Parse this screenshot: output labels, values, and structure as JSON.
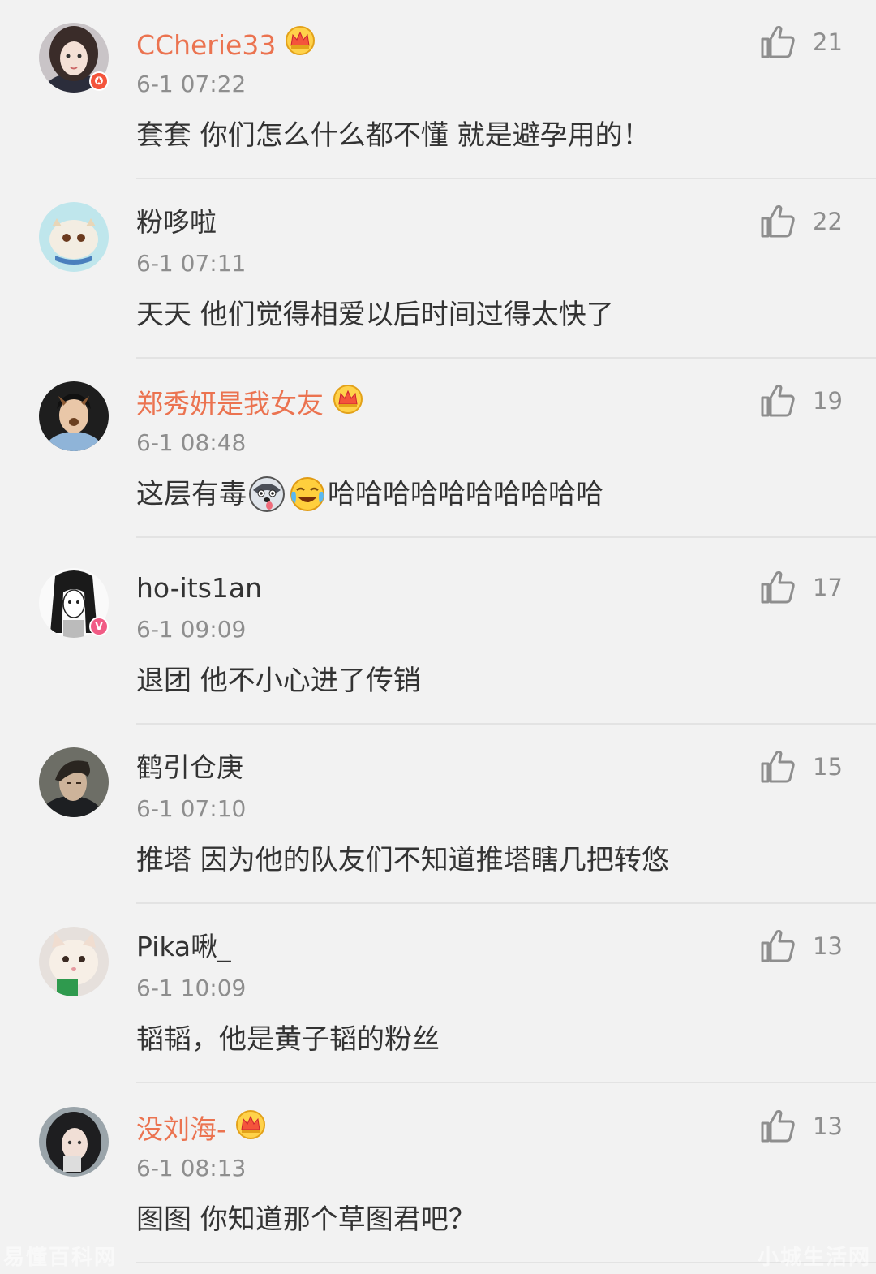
{
  "comments": [
    {
      "name": "CCherie33",
      "vip": true,
      "time": "6-1 07:22",
      "text_a": "套套 你们怎么什么都不懂 就是避孕用的！",
      "text_b": "",
      "likes": "21",
      "badge": "star"
    },
    {
      "name": "粉哆啦",
      "vip": false,
      "time": "6-1 07:11",
      "text_a": "天天  他们觉得相爱以后时间过得太快了",
      "text_b": "",
      "likes": "22",
      "badge": ""
    },
    {
      "name": "郑秀妍是我女友",
      "vip": true,
      "time": "6-1 08:48",
      "text_a": "这层有毒",
      "text_b": "哈哈哈哈哈哈哈哈哈哈",
      "likes": "19",
      "badge": ""
    },
    {
      "name": "ho-its1an",
      "vip": false,
      "time": "6-1 09:09",
      "text_a": "退团 他不小心进了传销",
      "text_b": "",
      "likes": "17",
      "badge": "v"
    },
    {
      "name": "鹤引仓庚",
      "vip": false,
      "time": "6-1 07:10",
      "text_a": "推塔  因为他的队友们不知道推塔瞎几把转悠",
      "text_b": "",
      "likes": "15",
      "badge": ""
    },
    {
      "name": "Pika啾_",
      "vip": false,
      "time": "6-1 10:09",
      "text_a": "韬韬，他是黄子韬的粉丝",
      "text_b": "",
      "likes": "13",
      "badge": ""
    },
    {
      "name": "没刘海-",
      "vip": true,
      "time": "6-1 08:13",
      "text_a": "图图  你知道那个草图君吧？",
      "text_b": "",
      "likes": "13",
      "badge": ""
    }
  ],
  "icons": {
    "like": "thumbs-up-icon",
    "vip": "crown-icon",
    "emoji_1": "husky-dog-emoji",
    "emoji_2": "laughing-crying-emoji"
  },
  "colors": {
    "vip_name": "#eb7350",
    "background": "#f2f2f2",
    "meta_gray": "#8e8e8e"
  },
  "watermarks": {
    "left": "易懂百科网",
    "right": "小城生活网"
  }
}
